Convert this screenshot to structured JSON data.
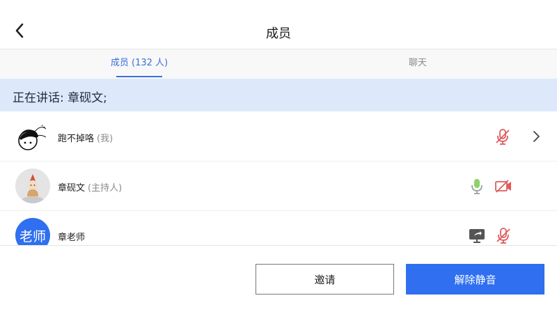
{
  "header": {
    "title": "成员"
  },
  "tabs": [
    {
      "label": "成员 (132 人)",
      "active": true
    },
    {
      "label": "聊天",
      "active": false
    }
  ],
  "speaking_bar": {
    "text": "正在讲话: 章砚文;"
  },
  "members": [
    {
      "name": "跑不掉咯",
      "role": "(我)",
      "icons": [
        "mic-muted-icon",
        "chevron-right-icon"
      ]
    },
    {
      "name": "章砚文",
      "role": "(主持人)",
      "icons": [
        "mic-active-icon",
        "camera-off-icon"
      ]
    },
    {
      "name": "章老师",
      "role": "",
      "avatar_text": "老师",
      "icons": [
        "screen-share-icon",
        "mic-muted-icon"
      ]
    }
  ],
  "footer": {
    "invite_label": "邀请",
    "unmute_label": "解除静音"
  },
  "colors": {
    "accent": "#2f6ff0",
    "tab_active": "#3a6fd8",
    "speaking_bg": "#dde9fb",
    "muted_red": "#e05a5a",
    "mic_green": "#8fd16a"
  }
}
